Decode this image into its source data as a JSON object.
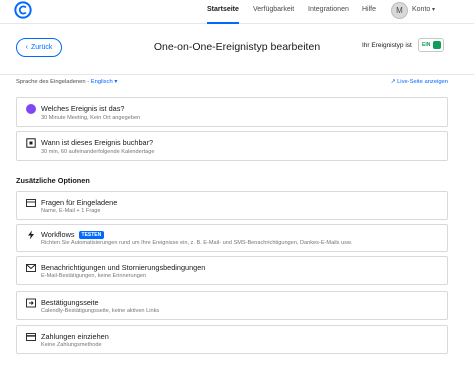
{
  "nav": {
    "items": [
      "Startseite",
      "Verfügbarkeit",
      "Integrationen",
      "Hilfe"
    ],
    "avatar_initial": "M",
    "account_label": "Konto"
  },
  "header": {
    "back_label": "Zurück",
    "title": "One-on-One-Ereignistyp bearbeiten",
    "status_label": "Ihr Ereignistyp ist",
    "toggle_label": "EIN"
  },
  "language": {
    "label": "Sprache des Eingeladenen -",
    "value": "Englisch",
    "live_link": "Live-Seite anzeigen"
  },
  "cards": [
    {
      "title": "Welches Ereignis ist das?",
      "subtitle": "30 Minute Meeting, Kein Ort angegeben",
      "icon": "purple-dot-icon"
    },
    {
      "title": "Wann ist dieses Ereignis buchbar?",
      "subtitle": "30 min, 60 aufeinanderfolgende Kalendertage",
      "icon": "calendar-icon"
    }
  ],
  "options": {
    "heading": "Zusätzliche Optionen",
    "items": [
      {
        "title": "Fragen für Eingeladene",
        "subtitle": "Name, E-Mail + 1 Frage",
        "icon": "form-icon"
      },
      {
        "title": "Workflows",
        "badge": "TESTEN",
        "subtitle": "Richten Sie Automatisierungen rund um Ihre Ereignisse ein, z. B. E-Mail- und SMS-Benachrichtigungen, Dankes-E-Mails usw.",
        "icon": "lightning-icon"
      },
      {
        "title": "Benachrichtigungen und Stornierungsbedingungen",
        "subtitle": "E-Mail-Bestätigungen, keine Erinnerungen",
        "icon": "envelope-icon"
      },
      {
        "title": "Bestätigungsseite",
        "subtitle": "Calendly-Bestätigungsseite, keine aktiven Links",
        "icon": "arrow-page-icon"
      },
      {
        "title": "Zahlungen einziehen",
        "subtitle": "Keine Zahlungsmethode",
        "icon": "credit-card-icon"
      }
    ]
  },
  "colors": {
    "accent": "#0069ff",
    "purple": "#8247f5",
    "success": "#0f9d58"
  }
}
